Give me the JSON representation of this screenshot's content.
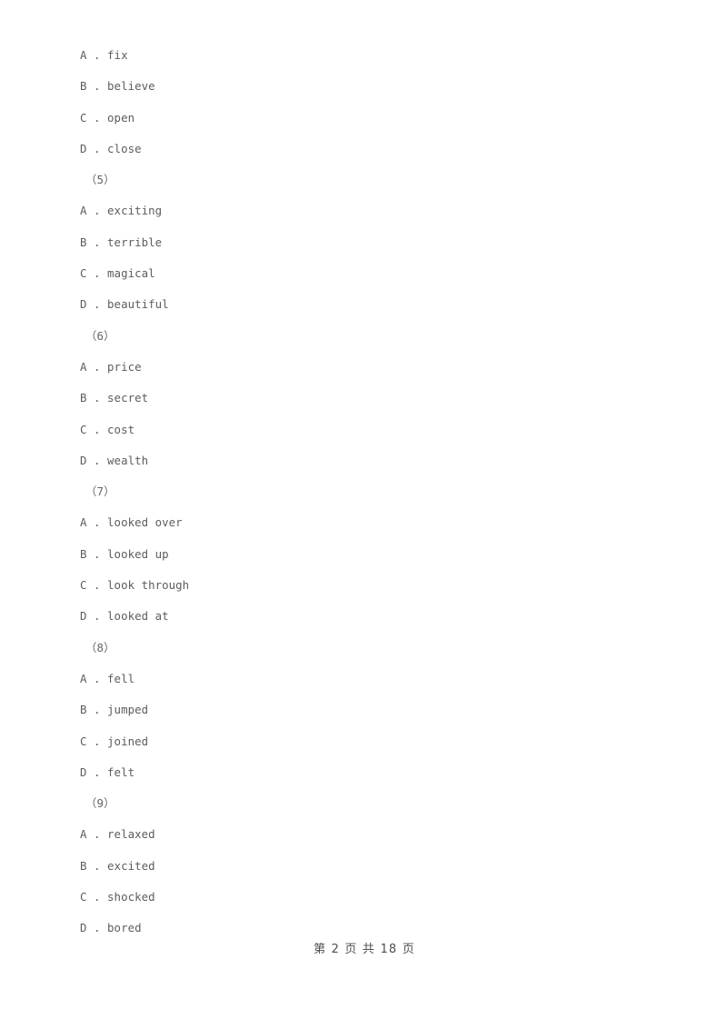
{
  "document": {
    "type": "exam-worksheet-page",
    "background_color": "#ffffff",
    "text_color": "#5d5d5d"
  },
  "body_lines": [
    {
      "kind": "option",
      "letter": "A",
      "sep": " . ",
      "text": "fix",
      "full": "A . fix"
    },
    {
      "kind": "option",
      "letter": "B",
      "sep": " . ",
      "text": "believe",
      "full": "B . believe"
    },
    {
      "kind": "option",
      "letter": "C",
      "sep": " . ",
      "text": "open",
      "full": "C . open"
    },
    {
      "kind": "option",
      "letter": "D",
      "sep": " . ",
      "text": "close",
      "full": "D . close"
    },
    {
      "kind": "qnum",
      "text": "（5）",
      "full": "（5）"
    },
    {
      "kind": "option",
      "letter": "A",
      "sep": " . ",
      "text": "exciting",
      "full": "A . exciting"
    },
    {
      "kind": "option",
      "letter": "B",
      "sep": " . ",
      "text": "terrible",
      "full": "B . terrible"
    },
    {
      "kind": "option",
      "letter": "C",
      "sep": " . ",
      "text": "magical",
      "full": "C . magical"
    },
    {
      "kind": "option",
      "letter": "D",
      "sep": " . ",
      "text": "beautiful",
      "full": "D . beautiful"
    },
    {
      "kind": "qnum",
      "text": "（6）",
      "full": "（6）"
    },
    {
      "kind": "option",
      "letter": "A",
      "sep": " . ",
      "text": "price",
      "full": "A . price"
    },
    {
      "kind": "option",
      "letter": "B",
      "sep": " . ",
      "text": "secret",
      "full": "B . secret"
    },
    {
      "kind": "option",
      "letter": "C",
      "sep": " . ",
      "text": "cost",
      "full": "C . cost"
    },
    {
      "kind": "option",
      "letter": "D",
      "sep": " . ",
      "text": "wealth",
      "full": "D . wealth"
    },
    {
      "kind": "qnum",
      "text": "（7）",
      "full": "（7）"
    },
    {
      "kind": "option",
      "letter": "A",
      "sep": " . ",
      "text": "looked over",
      "full": "A . looked over"
    },
    {
      "kind": "option",
      "letter": "B",
      "sep": " . ",
      "text": "looked up",
      "full": "B . looked up"
    },
    {
      "kind": "option",
      "letter": "C",
      "sep": " . ",
      "text": "look through",
      "full": "C . look through"
    },
    {
      "kind": "option",
      "letter": "D",
      "sep": " . ",
      "text": "looked at",
      "full": "D . looked at"
    },
    {
      "kind": "qnum",
      "text": "（8）",
      "full": "（8）"
    },
    {
      "kind": "option",
      "letter": "A",
      "sep": " . ",
      "text": "fell",
      "full": "A . fell"
    },
    {
      "kind": "option",
      "letter": "B",
      "sep": " . ",
      "text": "jumped",
      "full": "B . jumped"
    },
    {
      "kind": "option",
      "letter": "C",
      "sep": " . ",
      "text": "joined",
      "full": "C . joined"
    },
    {
      "kind": "option",
      "letter": "D",
      "sep": " . ",
      "text": "felt",
      "full": "D . felt"
    },
    {
      "kind": "qnum",
      "text": "（9）",
      "full": "（9）"
    },
    {
      "kind": "option",
      "letter": "A",
      "sep": " . ",
      "text": "relaxed",
      "full": "A . relaxed"
    },
    {
      "kind": "option",
      "letter": "B",
      "sep": " . ",
      "text": "excited",
      "full": "B . excited"
    },
    {
      "kind": "option",
      "letter": "C",
      "sep": " . ",
      "text": "shocked",
      "full": "C . shocked"
    },
    {
      "kind": "option",
      "letter": "D",
      "sep": " . ",
      "text": "bored",
      "full": "D . bored"
    }
  ],
  "footer": {
    "text": "第 2 页 共 18 页",
    "current_page": "2",
    "total_pages": "18"
  }
}
